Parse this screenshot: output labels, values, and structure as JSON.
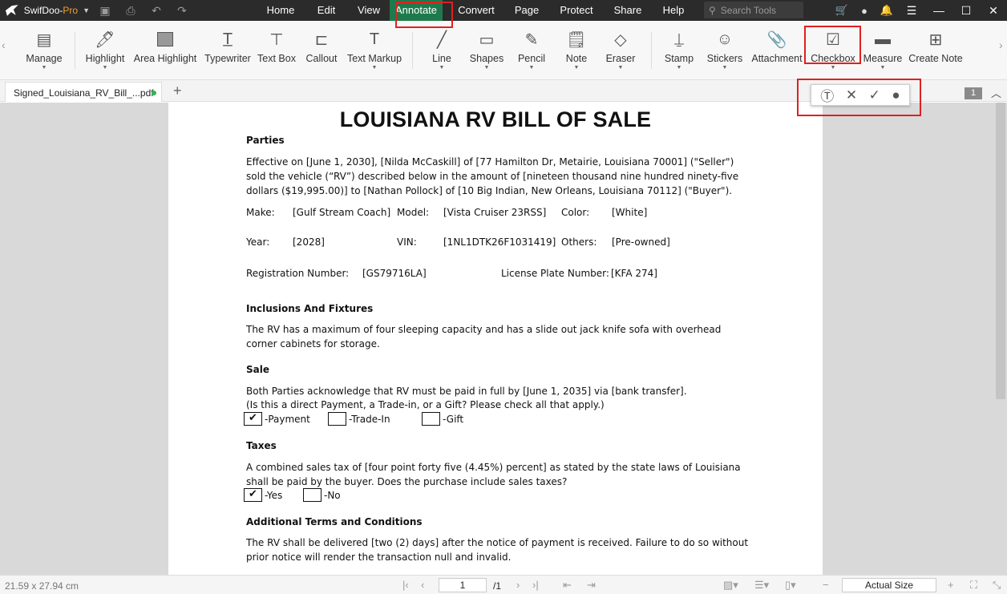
{
  "app": {
    "name": "SwifDoo-",
    "edition": "Pro"
  },
  "menus": [
    "Home",
    "Edit",
    "View",
    "Annotate",
    "Convert",
    "Page",
    "Protect",
    "Share",
    "Help"
  ],
  "active_menu": "Annotate",
  "search": {
    "placeholder": "Search Tools"
  },
  "ribbon": {
    "manage": "Manage",
    "highlight": "Highlight",
    "area_highlight": "Area Highlight",
    "typewriter": "Typewriter",
    "text_box": "Text Box",
    "callout": "Callout",
    "text_markup": "Text Markup",
    "line": "Line",
    "shapes": "Shapes",
    "pencil": "Pencil",
    "note": "Note",
    "eraser": "Eraser",
    "stamp": "Stamp",
    "stickers": "Stickers",
    "attachment": "Attachment",
    "checkbox": "Checkbox",
    "measure": "Measure",
    "create_note": "Create Note"
  },
  "tab": {
    "filename": "Signed_Louisiana_RV_Bill_...pdf"
  },
  "page_badge": "1",
  "document": {
    "title": "LOUISIANA RV BILL OF SALE",
    "parties_heading": "Parties",
    "parties_text": "Effective on [June 1, 2030], [Nilda McCaskill] of [77 Hamilton Dr, Metairie, Louisiana 70001] (\"Seller\") sold the vehicle (“RV”) described below in the amount of [nineteen thousand nine hundred ninety-five dollars ($19,995.00)] to [Nathan Pollock] of [10 Big Indian, New Orleans, Louisiana 70112] (\"Buyer\").",
    "make_label": "Make:",
    "make": "[Gulf Stream Coach]",
    "model_label": "Model:",
    "model": "[Vista Cruiser 23RSS]",
    "color_label": "Color:",
    "color": "[White]",
    "year_label": "Year:",
    "year": "[2028]",
    "vin_label": "VIN:",
    "vin": "[1NL1DTK26F1031419]",
    "others_label": "Others:",
    "others": "[Pre-owned]",
    "reg_label": "Registration Number:",
    "reg": "[GS79716LA]",
    "plate_label": "License Plate Number:",
    "plate": "[KFA 274]",
    "inclusions_heading": "Inclusions And Fixtures",
    "inclusions_text": "The RV has a maximum of four sleeping capacity and has a slide out jack knife sofa with overhead corner cabinets for storage.",
    "sale_heading": "Sale",
    "sale_text1": "Both Parties acknowledge that RV must be paid in full by [June 1, 2035] via [bank transfer].",
    "sale_text2": "(Is this a direct Payment, a Trade-in, or a Gift? Please check all that apply.)",
    "payment_label": "-Payment",
    "payment_mark": "✔",
    "tradein_label": "-Trade-In",
    "gift_label": "-Gift",
    "taxes_heading": "Taxes",
    "taxes_text": "A combined sales tax of [four point forty five (4.45%) percent] as stated by the state laws of Louisiana shall be paid by the buyer. Does the purchase include sales taxes?",
    "yes_label": "-Yes",
    "yes_mark": "✔",
    "no_label": "-No",
    "terms_heading": "Additional Terms and Conditions",
    "terms_text": "The RV shall be delivered [two (2) days] after the notice of payment is received. Failure to do so without prior notice will render the transaction null and invalid."
  },
  "status": {
    "dimensions": "21.59 x 27.94 cm",
    "current_page": "1",
    "total_pages": "/1",
    "zoom": "Actual Size"
  },
  "colors": {
    "active_menu": "#1e7a4c",
    "highlight_box": "#e02020",
    "saved_dot": "#2db84c"
  }
}
